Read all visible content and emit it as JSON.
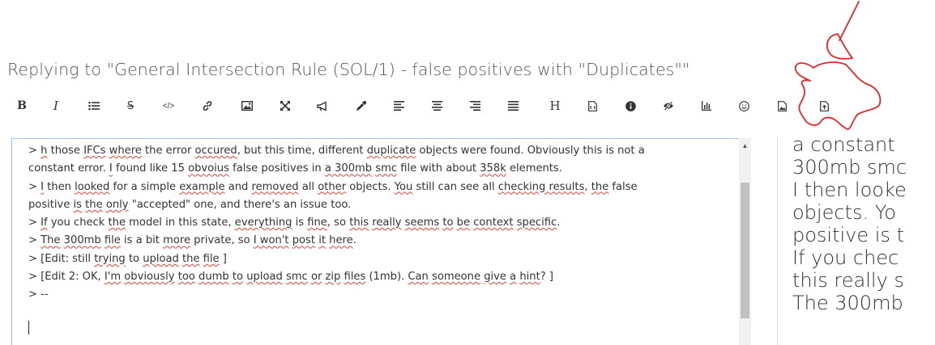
{
  "title": "Replying to \"General Intersection Rule (SOL/1) - false positives with \"Duplicates\"\"",
  "toolbar": {
    "bold": "B",
    "italic": "I",
    "heading": "H"
  },
  "editor": {
    "lines": [
      [
        {
          "t": "> "
        },
        {
          "t": "h",
          "s": 1
        },
        {
          "t": " those "
        },
        {
          "t": "IFCs",
          "s": 1
        },
        {
          "t": " "
        },
        {
          "t": "where",
          "s": 1
        },
        {
          "t": " the error "
        },
        {
          "t": "occured",
          "s": 1
        },
        {
          "t": ", but this time, different "
        },
        {
          "t": "duplicate",
          "s": 1
        },
        {
          "t": " objects were found. Obviously this is not a"
        }
      ],
      [
        {
          "t": "constant error. "
        },
        {
          "t": "I",
          "s": 1
        },
        {
          "t": " found like 15 "
        },
        {
          "t": "obvoius",
          "s": 1
        },
        {
          "t": " false positives in "
        },
        {
          "t": "a 300mb",
          "s": 1
        },
        {
          "t": " "
        },
        {
          "t": "smc",
          "s": 1
        },
        {
          "t": " file with about "
        },
        {
          "t": "358k",
          "s": 1
        },
        {
          "t": " elements."
        }
      ],
      [
        {
          "t": "> "
        },
        {
          "t": "I",
          "s": 1
        },
        {
          "t": " then "
        },
        {
          "t": "looked",
          "s": 1
        },
        {
          "t": " for a simple "
        },
        {
          "t": "example",
          "s": 1
        },
        {
          "t": " and "
        },
        {
          "t": "removed",
          "s": 1
        },
        {
          "t": " all "
        },
        {
          "t": "other",
          "s": 1
        },
        {
          "t": " objects. "
        },
        {
          "t": "You",
          "s": 1
        },
        {
          "t": " still can see all "
        },
        {
          "t": "checking results",
          "s": 1
        },
        {
          "t": ", "
        },
        {
          "t": "the",
          "s": 1
        },
        {
          "t": " false"
        }
      ],
      [
        {
          "t": "positive "
        },
        {
          "t": "is",
          "s": 1
        },
        {
          "t": " "
        },
        {
          "t": "the",
          "s": 1
        },
        {
          "t": " "
        },
        {
          "t": "only",
          "s": 1
        },
        {
          "t": " \"accepted\" one, and there's an issue too."
        }
      ],
      [
        {
          "t": "> "
        },
        {
          "t": "If",
          "s": 1
        },
        {
          "t": " you check "
        },
        {
          "t": "the",
          "s": 1
        },
        {
          "t": " model in this state, "
        },
        {
          "t": "everything",
          "s": 1
        },
        {
          "t": " is "
        },
        {
          "t": "fine",
          "s": 1
        },
        {
          "t": ", so "
        },
        {
          "t": "this",
          "s": 1
        },
        {
          "t": " "
        },
        {
          "t": "really",
          "s": 1
        },
        {
          "t": " "
        },
        {
          "t": "seems",
          "s": 1
        },
        {
          "t": " "
        },
        {
          "t": "to",
          "s": 1
        },
        {
          "t": " "
        },
        {
          "t": "be",
          "s": 1
        },
        {
          "t": " "
        },
        {
          "t": "context",
          "s": 1
        },
        {
          "t": " "
        },
        {
          "t": "specific",
          "s": 1
        },
        {
          "t": "."
        }
      ],
      [
        {
          "t": "> "
        },
        {
          "t": "The",
          "s": 1
        },
        {
          "t": " "
        },
        {
          "t": "300mb",
          "s": 1
        },
        {
          "t": " "
        },
        {
          "t": "file",
          "s": 1
        },
        {
          "t": " is a bit "
        },
        {
          "t": "more",
          "s": 1
        },
        {
          "t": " private, so "
        },
        {
          "t": "I won't",
          "s": 1
        },
        {
          "t": " "
        },
        {
          "t": "post",
          "s": 1
        },
        {
          "t": " "
        },
        {
          "t": "it",
          "s": 1
        },
        {
          "t": " "
        },
        {
          "t": "here",
          "s": 1
        },
        {
          "t": "."
        }
      ],
      [
        {
          "t": "> [Edit: still "
        },
        {
          "t": "trying",
          "s": 1
        },
        {
          "t": " to "
        },
        {
          "t": "upload",
          "s": 1
        },
        {
          "t": " "
        },
        {
          "t": "the",
          "s": 1
        },
        {
          "t": " "
        },
        {
          "t": "file",
          "s": 1
        },
        {
          "t": "  ]"
        }
      ],
      [
        {
          "t": "> [Edit 2: OK, "
        },
        {
          "t": "I'm",
          "s": 1
        },
        {
          "t": " "
        },
        {
          "t": "obviously",
          "s": 1
        },
        {
          "t": " "
        },
        {
          "t": "too",
          "s": 1
        },
        {
          "t": " "
        },
        {
          "t": "dumb",
          "s": 1
        },
        {
          "t": " "
        },
        {
          "t": "to",
          "s": 1
        },
        {
          "t": " "
        },
        {
          "t": "upload",
          "s": 1
        },
        {
          "t": " "
        },
        {
          "t": "smc",
          "s": 1
        },
        {
          "t": " "
        },
        {
          "t": "or",
          "s": 1
        },
        {
          "t": " "
        },
        {
          "t": "zip",
          "s": 1
        },
        {
          "t": " "
        },
        {
          "t": "files",
          "s": 1
        },
        {
          "t": " (1mb). "
        },
        {
          "t": "Can",
          "s": 1
        },
        {
          "t": " "
        },
        {
          "t": "someone",
          "s": 1
        },
        {
          "t": " "
        },
        {
          "t": "give",
          "s": 1
        },
        {
          "t": " "
        },
        {
          "t": "a",
          "s": 1
        },
        {
          "t": " "
        },
        {
          "t": "hint",
          "s": 1
        },
        {
          "t": "?  ]"
        }
      ],
      [
        {
          "t": "> --"
        }
      ]
    ]
  },
  "preview": {
    "lines": [
      "a constant",
      "300mb smc",
      "I then looke",
      "objects. Yo",
      "positive is t",
      "If you chec",
      "this really s",
      "The 300mb"
    ]
  },
  "colors": {
    "annotation": "#e8242a",
    "editor_border": "#9ec3e6",
    "spell_underline": "#e34234"
  }
}
